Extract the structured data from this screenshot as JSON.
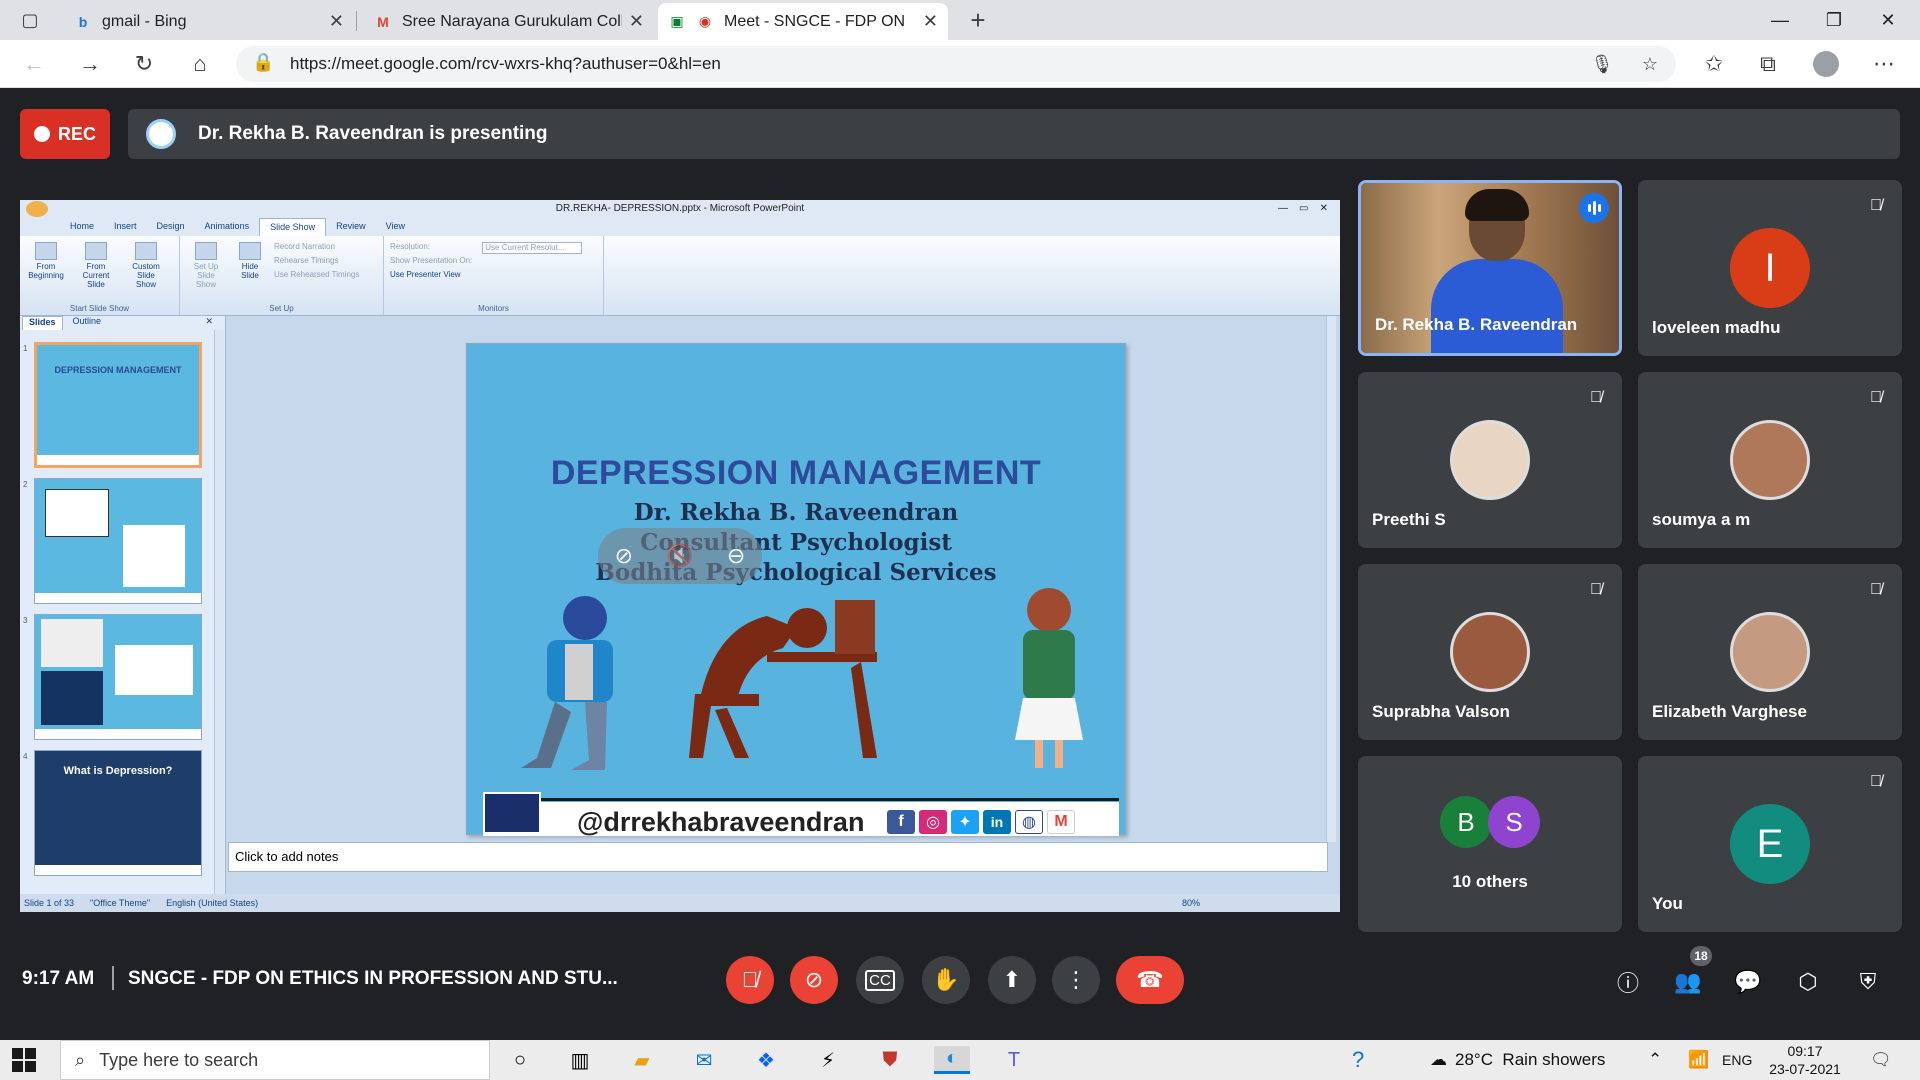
{
  "browser": {
    "tabs": [
      {
        "title": "gmail - Bing",
        "icon": "bing-icon"
      },
      {
        "title": "Sree Narayana Gurukulam College",
        "icon": "gmail-icon"
      },
      {
        "title": "Meet - SNGCE - FDP ON ETHICS",
        "icon": "meet-icon"
      }
    ],
    "url": "https://meet.google.com/rcv-wxrs-khq?authuser=0&hl=en"
  },
  "meet": {
    "rec_label": "REC",
    "presenting_text": "Dr. Rekha B. Raveendran is presenting",
    "time": "9:17 AM",
    "meeting_title": "SNGCE - FDP ON ETHICS IN PROFESSION AND STU...",
    "participant_count": "18",
    "accent": "#1a73e8",
    "danger": "#ea4335"
  },
  "participants": [
    {
      "name": "Dr. Rekha B. Raveendran",
      "type": "video",
      "speaking": true
    },
    {
      "name": "loveleen madhu",
      "initial": "I",
      "color": "#d93d17",
      "muted": true
    },
    {
      "name": "Preethi S",
      "type": "photo",
      "muted": true
    },
    {
      "name": "soumya a m",
      "type": "photo",
      "muted": true
    },
    {
      "name": "Suprabha Valson",
      "type": "photo",
      "muted": true
    },
    {
      "name": "Elizabeth Varghese",
      "type": "photo",
      "muted": true
    },
    {
      "name": "You",
      "initial": "E",
      "color": "#128c7e",
      "muted": true
    }
  ],
  "others": {
    "label": "10 others",
    "initials": [
      {
        "letter": "B",
        "color": "#188038"
      },
      {
        "letter": "S",
        "color": "#8e44cf"
      }
    ]
  },
  "ppt": {
    "window_title": "DR.REKHA- DEPRESSION.pptx - Microsoft PowerPoint",
    "tabs": [
      "Home",
      "Insert",
      "Design",
      "Animations",
      "Slide Show",
      "Review",
      "View"
    ],
    "active_tab": "Slide Show",
    "groups": {
      "start": "Start Slide Show",
      "setup": "Set Up",
      "monitors": "Monitors"
    },
    "buttons": {
      "from_beginning": "From Beginning",
      "from_current": "From Current Slide",
      "custom": "Custom Slide Show",
      "setup_show": "Set Up Slide Show",
      "hide_slide": "Hide Slide"
    },
    "setup_items": [
      "Record Narration",
      "Rehearse Timings",
      "Use Rehearsed Timings"
    ],
    "monitor_items": [
      "Resolution:",
      "Show Presentation On:",
      "Use Presenter View"
    ],
    "resolution_value": "Use Current Resolut...",
    "pane_tabs": [
      "Slides",
      "Outline"
    ],
    "thumbs": [
      {
        "num": "1",
        "title": "DEPRESSION MANAGEMENT"
      },
      {
        "num": "2",
        "title": ""
      },
      {
        "num": "3",
        "title": ""
      },
      {
        "num": "4",
        "title": "What is Depression?"
      }
    ],
    "notes_placeholder": "Click to add notes",
    "status": [
      "Slide 1 of 33",
      "\"Office Theme\"",
      "English (United States)"
    ],
    "zoom": "80%"
  },
  "slide": {
    "title": "DEPRESSION MANAGEMENT",
    "lines": [
      "Dr. Rekha B. Raveendran",
      "Consultant Psychologist",
      "Bodhita Psychological Services"
    ],
    "handle": "@drrekhabraveendran"
  },
  "taskbar": {
    "search_placeholder": "Type here to search",
    "weather": "28°C  Rain showers",
    "lang": "ENG",
    "time": "09:17",
    "date": "23-07-2021"
  }
}
